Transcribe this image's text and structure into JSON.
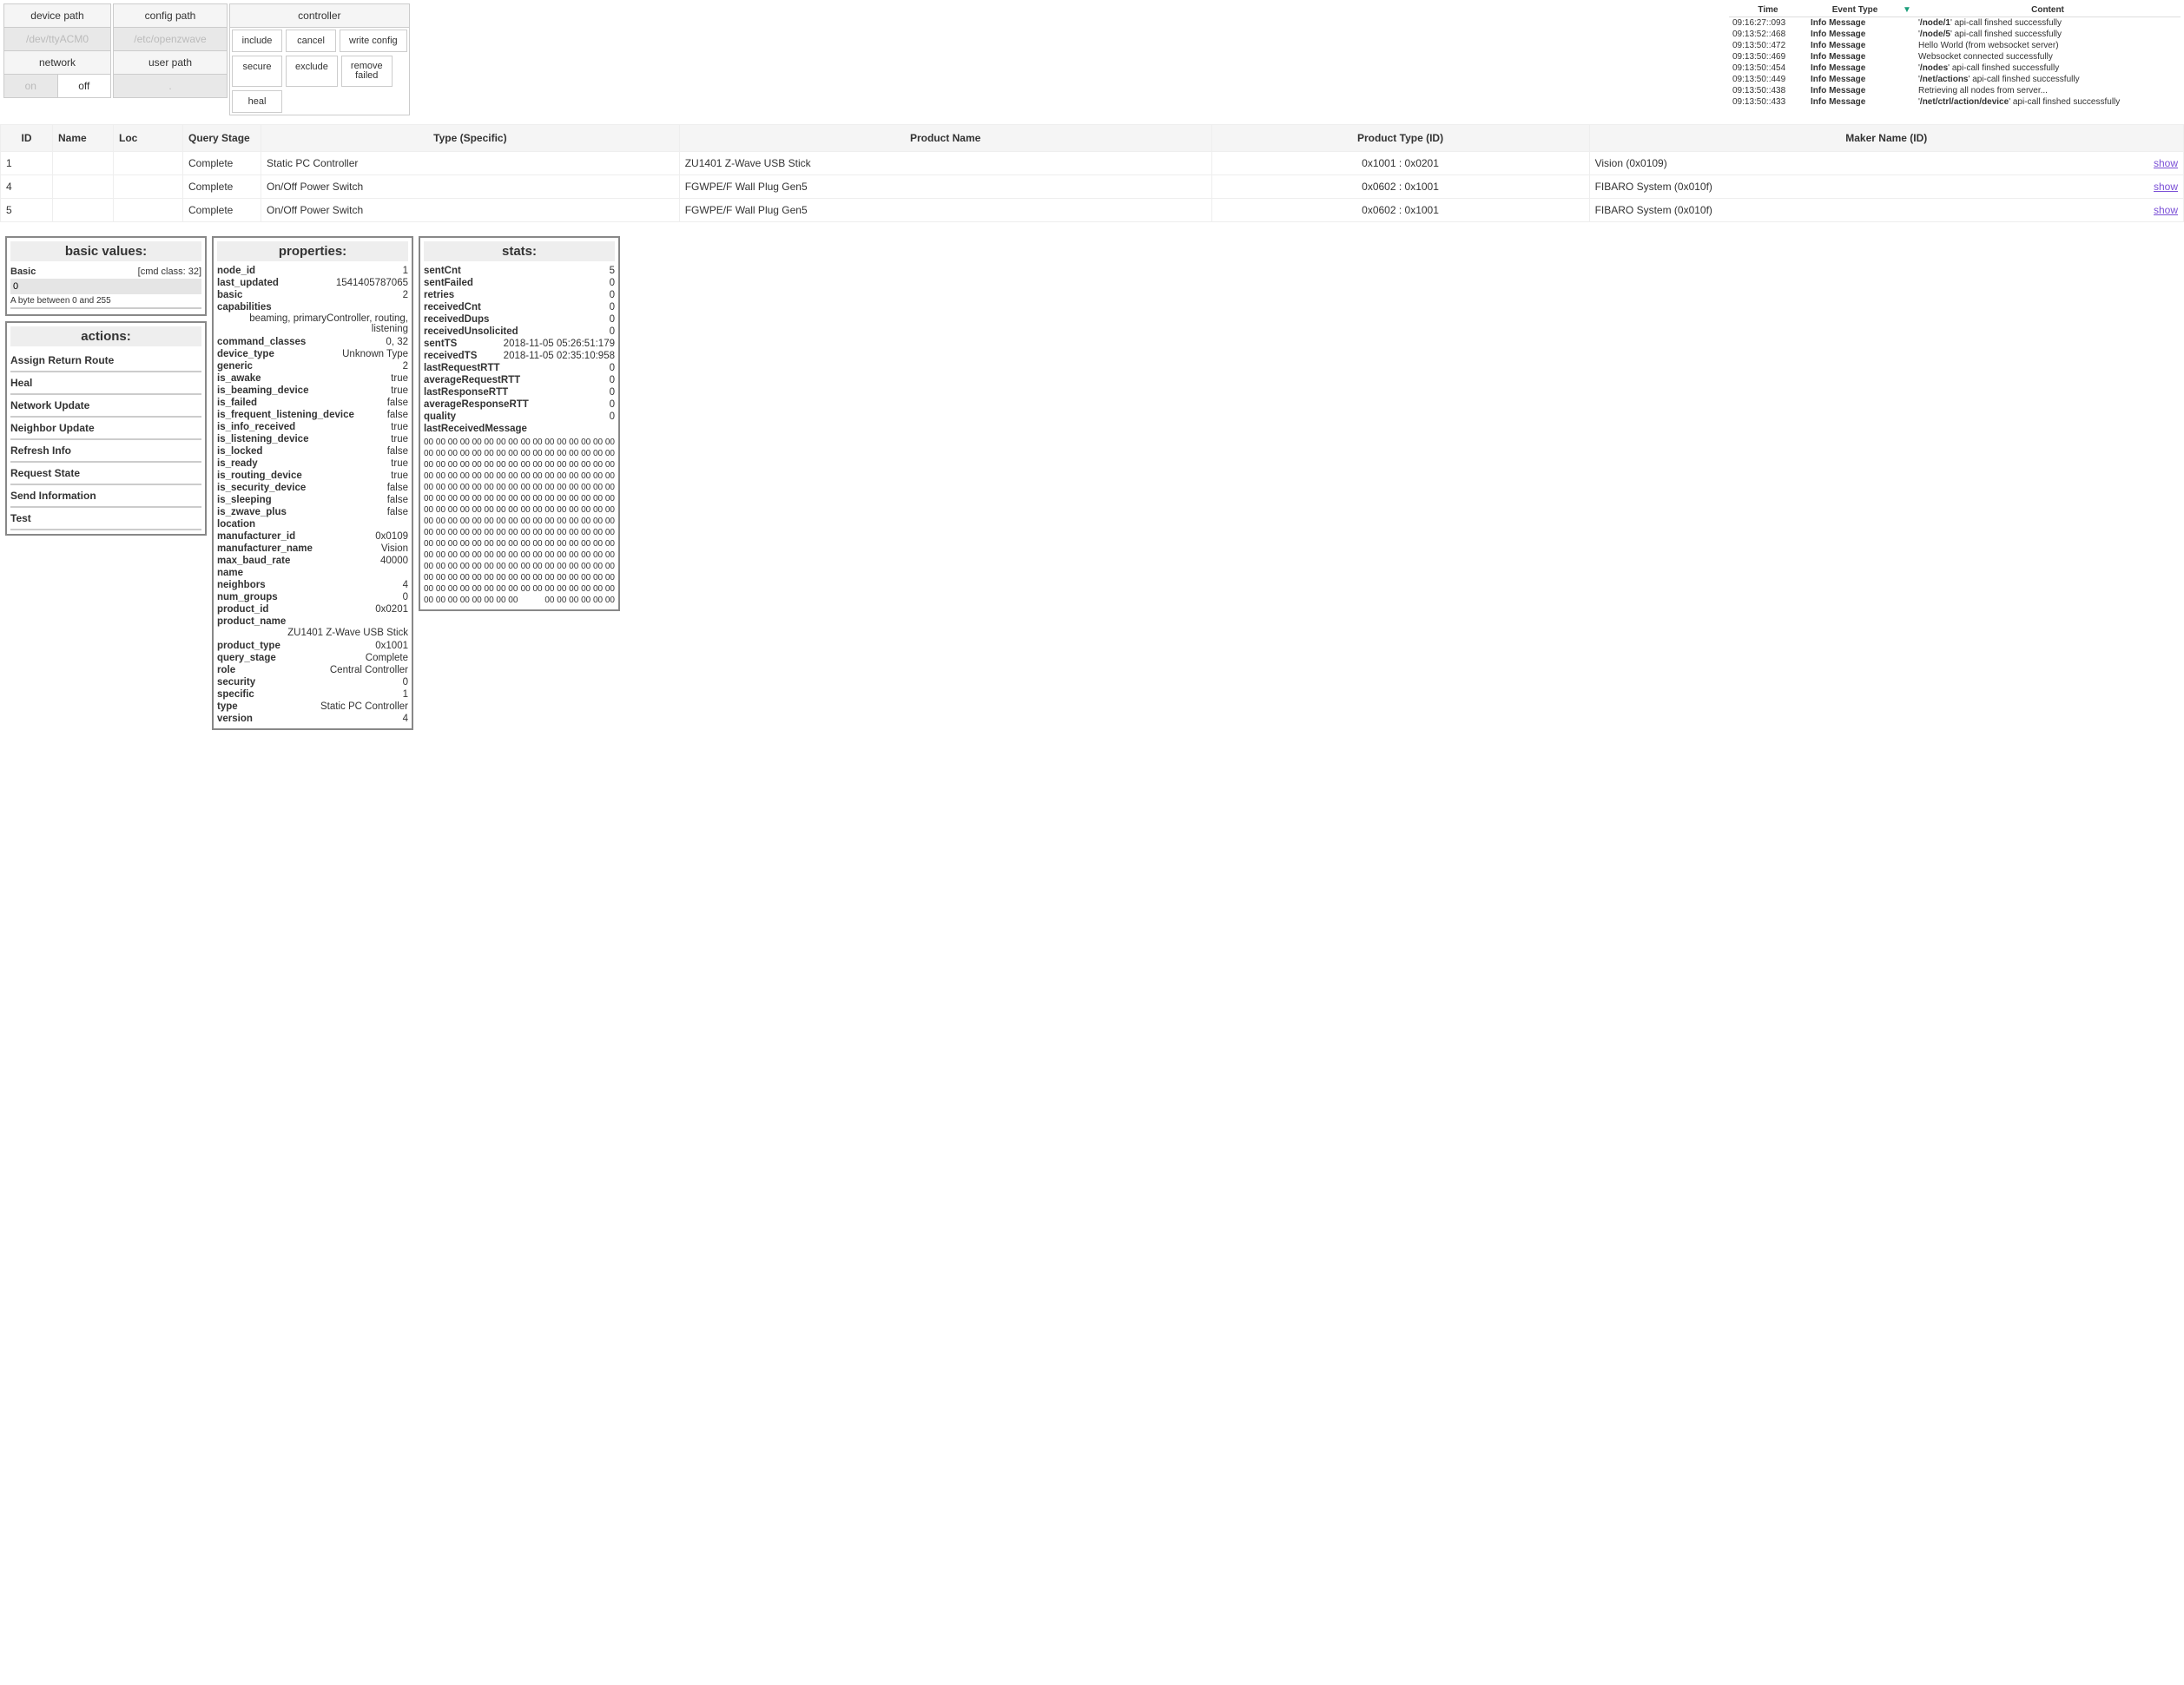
{
  "top": {
    "device_path": {
      "label": "device path",
      "value": "/dev/ttyACM0"
    },
    "config_path": {
      "label": "config path",
      "value": "/etc/openzwave"
    },
    "network": {
      "label": "network",
      "on": "on",
      "off": "off"
    },
    "user_path": {
      "label": "user path",
      "value": "."
    },
    "controller": {
      "label": "controller",
      "include": "include",
      "cancel": "cancel",
      "write_config": "write config",
      "secure": "secure",
      "exclude": "exclude",
      "remove_failed": "remove\nfailed",
      "heal": "heal"
    }
  },
  "log": {
    "headers": {
      "time": "Time",
      "type": "Event Type",
      "content": "Content",
      "arrow": "▼"
    },
    "rows": [
      {
        "time": "09:16:27::093",
        "type": "Info Message",
        "content": "'/node/1' api-call finshed successfully"
      },
      {
        "time": "09:13:52::468",
        "type": "Info Message",
        "content": "'/node/5' api-call finshed successfully"
      },
      {
        "time": "09:13:50::472",
        "type": "Info Message",
        "content": "Hello World (from websocket server)"
      },
      {
        "time": "09:13:50::469",
        "type": "Info Message",
        "content": "Websocket connected successfully"
      },
      {
        "time": "09:13:50::454",
        "type": "Info Message",
        "content": "'/nodes' api-call finshed successfully"
      },
      {
        "time": "09:13:50::449",
        "type": "Info Message",
        "content": "'/net/actions' api-call finshed successfully"
      },
      {
        "time": "09:13:50::438",
        "type": "Info Message",
        "content": "Retrieving all nodes from server..."
      },
      {
        "time": "09:13:50::433",
        "type": "Info Message",
        "content": "'/net/ctrl/action/device' api-call finshed successfully"
      }
    ]
  },
  "nodes": {
    "headers": {
      "id": "ID",
      "name": "Name",
      "loc": "Loc",
      "query": "Query Stage",
      "type": "Type (Specific)",
      "product": "Product Name",
      "ptype": "Product Type (ID)",
      "maker": "Maker Name (ID)",
      "show": "show"
    },
    "rows": [
      {
        "id": "1",
        "name": "",
        "loc": "",
        "query": "Complete",
        "type": "Static PC Controller",
        "product": "ZU1401 Z-Wave USB Stick",
        "ptype": "0x1001 : 0x0201",
        "maker": "Vision (0x0109)"
      },
      {
        "id": "4",
        "name": "",
        "loc": "",
        "query": "Complete",
        "type": "On/Off Power Switch",
        "product": "FGWPE/F Wall Plug Gen5",
        "ptype": "0x0602 : 0x1001",
        "maker": "FIBARO System (0x010f)"
      },
      {
        "id": "5",
        "name": "",
        "loc": "",
        "query": "Complete",
        "type": "On/Off Power Switch",
        "product": "FGWPE/F Wall Plug Gen5",
        "ptype": "0x0602 : 0x1001",
        "maker": "FIBARO System (0x010f)"
      }
    ]
  },
  "basic": {
    "title": "basic values:",
    "label": "Basic",
    "cmd_class": "[cmd class: 32]",
    "value": "0",
    "hint": "A byte between 0 and 255"
  },
  "actions": {
    "title": "actions:",
    "items": [
      "Assign Return Route",
      "Heal",
      "Network Update",
      "Neighbor Update",
      "Refresh Info",
      "Request State",
      "Send Information",
      "Test"
    ]
  },
  "props": {
    "title": "properties:",
    "rows": [
      {
        "k": "node_id",
        "v": "1"
      },
      {
        "k": "last_updated",
        "v": "1541405787065"
      },
      {
        "k": "basic",
        "v": "2"
      },
      {
        "k": "capabilities",
        "v": ""
      },
      {
        "k": "",
        "v": "beaming, primaryController, routing, listening",
        "wrap": true
      },
      {
        "k": "command_classes",
        "v": "0, 32"
      },
      {
        "k": "device_type",
        "v": "Unknown Type"
      },
      {
        "k": "generic",
        "v": "2"
      },
      {
        "k": "is_awake",
        "v": "true"
      },
      {
        "k": "is_beaming_device",
        "v": "true"
      },
      {
        "k": "is_failed",
        "v": "false"
      },
      {
        "k": "is_frequent_listening_device",
        "v": "false"
      },
      {
        "k": "is_info_received",
        "v": "true"
      },
      {
        "k": "is_listening_device",
        "v": "true"
      },
      {
        "k": "is_locked",
        "v": "false"
      },
      {
        "k": "is_ready",
        "v": "true"
      },
      {
        "k": "is_routing_device",
        "v": "true"
      },
      {
        "k": "is_security_device",
        "v": "false"
      },
      {
        "k": "is_sleeping",
        "v": "false"
      },
      {
        "k": "is_zwave_plus",
        "v": "false"
      },
      {
        "k": "location",
        "v": ""
      },
      {
        "k": "manufacturer_id",
        "v": "0x0109"
      },
      {
        "k": "manufacturer_name",
        "v": "Vision"
      },
      {
        "k": "max_baud_rate",
        "v": "40000"
      },
      {
        "k": "name",
        "v": ""
      },
      {
        "k": "neighbors",
        "v": "4"
      },
      {
        "k": "num_groups",
        "v": "0"
      },
      {
        "k": "product_id",
        "v": "0x0201"
      },
      {
        "k": "product_name",
        "v": ""
      },
      {
        "k": "",
        "v": "ZU1401 Z-Wave USB Stick",
        "wrap": true
      },
      {
        "k": "product_type",
        "v": "0x1001"
      },
      {
        "k": "query_stage",
        "v": "Complete"
      },
      {
        "k": "role",
        "v": "Central Controller"
      },
      {
        "k": "security",
        "v": "0"
      },
      {
        "k": "specific",
        "v": "1"
      },
      {
        "k": "type",
        "v": "Static PC Controller"
      },
      {
        "k": "version",
        "v": "4"
      }
    ]
  },
  "stats": {
    "title": "stats:",
    "rows": [
      {
        "k": "sentCnt",
        "v": "5"
      },
      {
        "k": "sentFailed",
        "v": "0"
      },
      {
        "k": "retries",
        "v": "0"
      },
      {
        "k": "receivedCnt",
        "v": "0"
      },
      {
        "k": "receivedDups",
        "v": "0"
      },
      {
        "k": "receivedUnsolicited",
        "v": "0"
      },
      {
        "k": "sentTS",
        "v": "2018-11-05 05:26:51:179"
      },
      {
        "k": "receivedTS",
        "v": "2018-11-05 02:35:10:958"
      },
      {
        "k": "lastRequestRTT",
        "v": "0"
      },
      {
        "k": "averageRequestRTT",
        "v": "0"
      },
      {
        "k": "lastResponseRTT",
        "v": "0"
      },
      {
        "k": "averageResponseRTT",
        "v": "0"
      },
      {
        "k": "quality",
        "v": "0"
      },
      {
        "k": "lastReceivedMessage",
        "v": ""
      }
    ],
    "hex_left": "00 00 00 00 00 00 00 00",
    "hex_right": "00 00 00 00 00 00 00 00",
    "hex_last_right": "00 00 00 00 00 00",
    "hex_rows": 15
  }
}
